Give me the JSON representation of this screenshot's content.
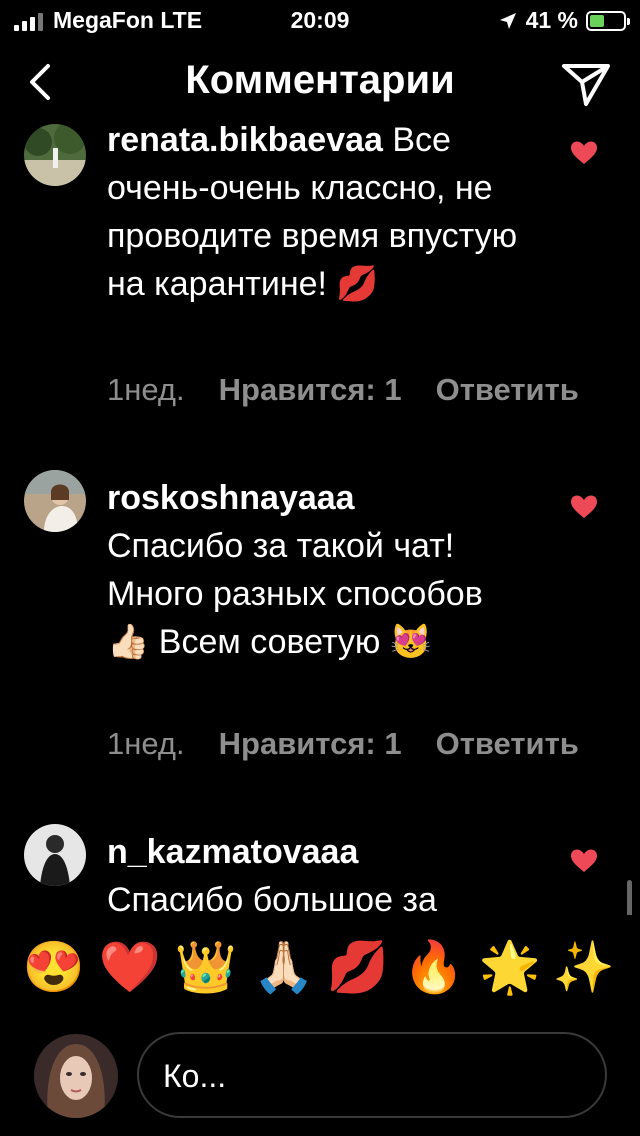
{
  "status": {
    "carrier": "MegaFon LTE",
    "time": "20:09",
    "battery": "41 %"
  },
  "header": {
    "title": "Комментарии"
  },
  "comments": [
    {
      "username": "renata.bikbaevaa",
      "text": " Все очень-очень классно, не проводите время впустую на карантине! 💋",
      "time": "1нед.",
      "likes": "Нравится: 1",
      "reply": "Ответить"
    },
    {
      "username": "roskoshnayaaa",
      "text": "Спасибо за такой чат! Много разных способов 👍🏻 Всем советую 😻",
      "time": "1нед.",
      "likes": "Нравится: 1",
      "reply": "Ответить"
    },
    {
      "username": "n_kazmatovaaa",
      "text": "Спасибо большое за"
    }
  ],
  "emoji_bar": [
    "😍",
    "❤️",
    "👑",
    "🙏🏻",
    "💋",
    "🔥",
    "🌟",
    "✨"
  ],
  "input": {
    "placeholder": "Ко..."
  },
  "colors": {
    "background": "#000000",
    "meta_text": "#8e8e8e",
    "heart": "#ed4956",
    "battery": "#6ad15a"
  }
}
